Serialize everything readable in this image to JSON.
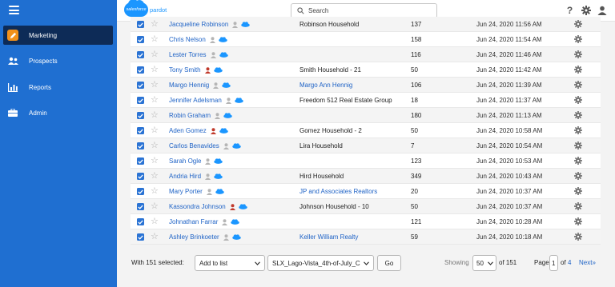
{
  "app": {
    "logo_text": "salesforce",
    "product_text": "pardot"
  },
  "search": {
    "placeholder": "Search"
  },
  "sidebar": {
    "items": [
      {
        "label": "Marketing",
        "icon": "pencil-icon",
        "active": true
      },
      {
        "label": "Prospects",
        "icon": "people-icon",
        "active": false
      },
      {
        "label": "Reports",
        "icon": "bar-chart-icon",
        "active": false
      },
      {
        "label": "Admin",
        "icon": "briefcase-icon",
        "active": false
      }
    ]
  },
  "colors": {
    "sidebar": "#1f6fd1",
    "active_nav": "#0d2b57",
    "accent_orange": "#f2911b",
    "link_blue": "#1f63c6",
    "sf_cloud": "#1b96ff",
    "prospect_red": "#c0392b"
  },
  "rows": [
    {
      "name": "Jacqueline Robinson",
      "person_color": "gray",
      "company": "Robinson Household",
      "company_link": false,
      "score": "137",
      "date": "Jun 24, 2020 11:56 AM"
    },
    {
      "name": "Chris Nelson",
      "person_color": "gray",
      "company": "",
      "company_link": false,
      "score": "158",
      "date": "Jun 24, 2020 11:54 AM"
    },
    {
      "name": "Lester Torres",
      "person_color": "gray",
      "company": "",
      "company_link": false,
      "score": "116",
      "date": "Jun 24, 2020 11:46 AM"
    },
    {
      "name": "Tony Smith",
      "person_color": "red",
      "company": "Smith Household - 21",
      "company_link": false,
      "score": "50",
      "date": "Jun 24, 2020 11:42 AM"
    },
    {
      "name": "Margo Hennig",
      "person_color": "gray",
      "company": "Margo Ann Hennig",
      "company_link": true,
      "score": "106",
      "date": "Jun 24, 2020 11:39 AM"
    },
    {
      "name": "Jennifer Adelsman",
      "person_color": "gray",
      "company": "Freedom 512 Real Estate Group",
      "company_link": false,
      "score": "18",
      "date": "Jun 24, 2020 11:37 AM"
    },
    {
      "name": "Robin Graham",
      "person_color": "gray",
      "company": "",
      "company_link": false,
      "score": "180",
      "date": "Jun 24, 2020 11:13 AM"
    },
    {
      "name": "Aden Gomez",
      "person_color": "red",
      "company": "Gomez Household - 2",
      "company_link": false,
      "score": "50",
      "date": "Jun 24, 2020 10:58 AM"
    },
    {
      "name": "Carlos Benavides",
      "person_color": "gray",
      "company": "Lira Household",
      "company_link": false,
      "score": "7",
      "date": "Jun 24, 2020 10:54 AM"
    },
    {
      "name": "Sarah Ogle",
      "person_color": "gray",
      "company": "",
      "company_link": false,
      "score": "123",
      "date": "Jun 24, 2020 10:53 AM"
    },
    {
      "name": "Andria Hird",
      "person_color": "gray",
      "company": "Hird Household",
      "company_link": false,
      "score": "349",
      "date": "Jun 24, 2020 10:43 AM"
    },
    {
      "name": "Mary Porter",
      "person_color": "gray",
      "company": "JP and Associates Realtors",
      "company_link": true,
      "score": "20",
      "date": "Jun 24, 2020 10:37 AM"
    },
    {
      "name": "Kassondra Johnson",
      "person_color": "red",
      "company": "Johnson Household - 10",
      "company_link": false,
      "score": "50",
      "date": "Jun 24, 2020 10:37 AM"
    },
    {
      "name": "Johnathan Farrar",
      "person_color": "gray",
      "company": "",
      "company_link": false,
      "score": "121",
      "date": "Jun 24, 2020 10:28 AM"
    },
    {
      "name": "Ashley Brinkoeter",
      "person_color": "gray",
      "company": "Keller William Realty",
      "company_link": true,
      "score": "59",
      "date": "Jun 24, 2020 10:18 AM"
    }
  ],
  "footer": {
    "selected_label": "With 151 selected:",
    "action_select": "Add to list",
    "list_select": "SLX_Lago-Vista_4th-of-July_C",
    "go_label": "Go",
    "showing_label": "Showing",
    "per_page": "50",
    "of_total": "of 151",
    "page_label": "Page",
    "page_current": "1",
    "page_of": "of",
    "page_total": "4",
    "next_label": "Next»"
  }
}
